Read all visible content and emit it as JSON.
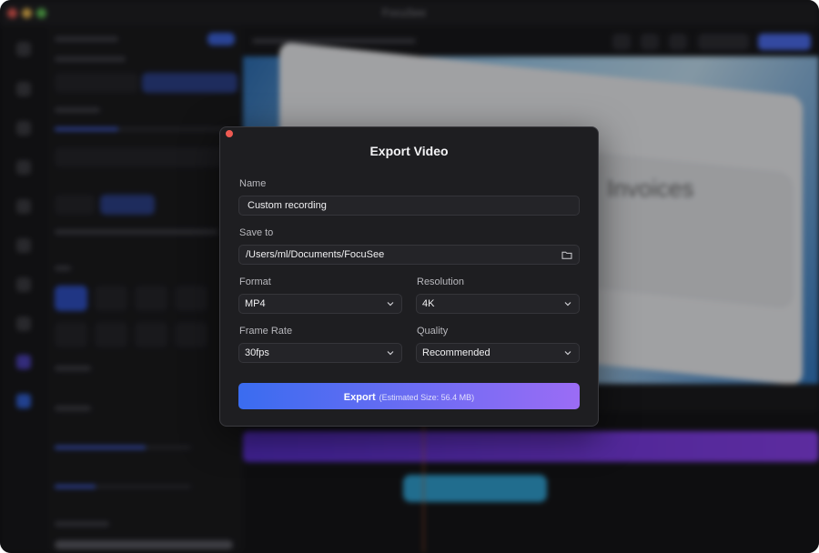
{
  "app": {
    "title": "FocuSee"
  },
  "background": {
    "slide_text": "Invoices"
  },
  "export_dialog": {
    "title": "Export Video",
    "name": {
      "label": "Name",
      "value": "Custom recording"
    },
    "save_to": {
      "label": "Save to",
      "value": "/Users/ml/Documents/FocuSee",
      "icon": "folder-icon"
    },
    "format": {
      "label": "Format",
      "value": "MP4",
      "icon": "chevron-down-icon"
    },
    "resolution": {
      "label": "Resolution",
      "value": "4K",
      "icon": "chevron-down-icon"
    },
    "frame_rate": {
      "label": "Frame Rate",
      "value": "30fps",
      "icon": "chevron-down-icon"
    },
    "quality": {
      "label": "Quality",
      "value": "Recommended",
      "icon": "chevron-down-icon"
    },
    "export_button": {
      "label": "Export",
      "estimate": "(Estimated Size: 56.4 MB)"
    }
  },
  "colors": {
    "accent_start": "#3a6cf0",
    "accent_end": "#9b6cf5",
    "close_dot": "#ee5a52",
    "dialog_bg": "#1e1e21"
  }
}
